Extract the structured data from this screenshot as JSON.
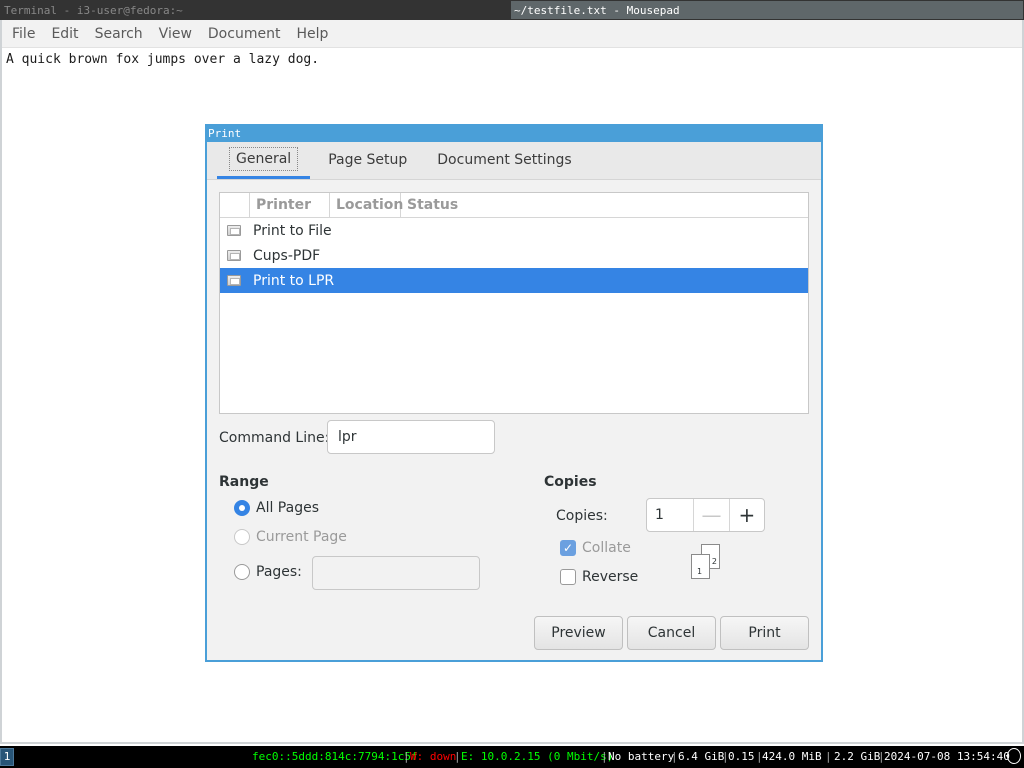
{
  "titlebars": {
    "left": "Terminal - i3-user@fedora:~",
    "right": "~/testfile.txt - Mousepad"
  },
  "menubar": [
    "File",
    "Edit",
    "Search",
    "View",
    "Document",
    "Help"
  ],
  "editor": {
    "text": "A quick brown fox jumps over a lazy dog."
  },
  "dialog": {
    "title": "Print",
    "tabs": [
      "General",
      "Page Setup",
      "Document Settings"
    ],
    "printer_columns": [
      "Printer",
      "Location",
      "Status"
    ],
    "printers": [
      "Print to File",
      "Cups-PDF",
      "Print to LPR"
    ],
    "selected_printer": "Print to LPR",
    "command_label": "Command Line:",
    "command_value": "lpr",
    "range": {
      "heading": "Range",
      "all_pages": "All Pages",
      "current_page": "Current Page",
      "pages": "Pages:"
    },
    "copies": {
      "heading": "Copies",
      "label": "Copies:",
      "value": "1",
      "collate": "Collate",
      "reverse": "Reverse",
      "page1": "1",
      "page2": "2"
    },
    "buttons": {
      "preview": "Preview",
      "cancel": "Cancel",
      "print": "Print"
    }
  },
  "statusbar": {
    "workspace": "1",
    "ipv6": "fec0::5ddd:814c:7794:1c5f",
    "wifi": "W: down",
    "eth": "E: 10.0.2.15 (0 Mbit/s)",
    "battery": "No battery",
    "disk": "6.4 GiB",
    "load": "0.15",
    "mem": "424.0 MiB",
    "swap": "2.2 GiB",
    "datetime": "2024-07-08 13:54:40",
    "colors": {
      "ipv6": "#00ff00",
      "wifi": "#ff0000",
      "eth": "#00ff00",
      "default": "#ffffff"
    }
  }
}
